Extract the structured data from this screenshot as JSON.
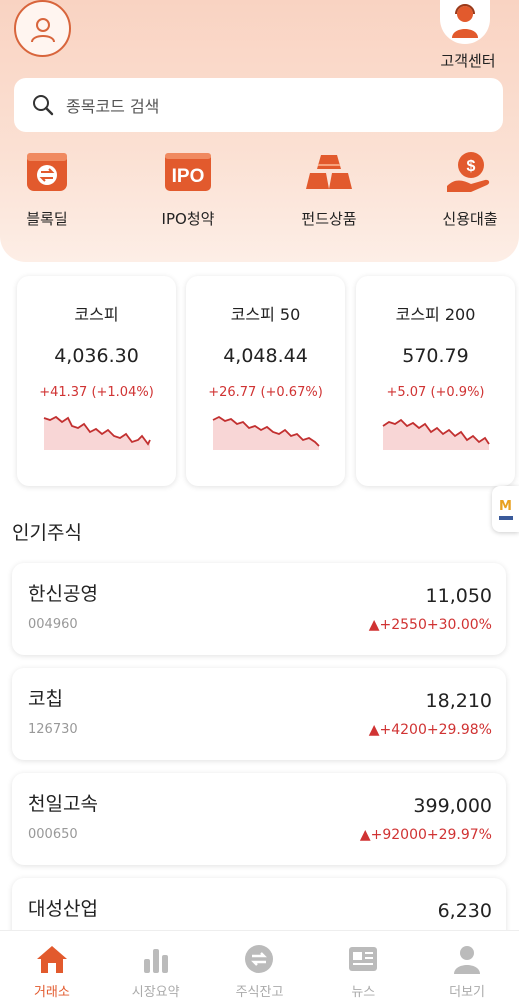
{
  "header": {
    "customer_center_label": "고객센터",
    "search_placeholder": "종목코드 검색"
  },
  "quick_menu": [
    {
      "label": "블록딜",
      "icon": "exchange-icon"
    },
    {
      "label": "IPO청약",
      "icon": "ipo-icon"
    },
    {
      "label": "펀드상품",
      "icon": "gold-bars-icon"
    },
    {
      "label": "신용대출",
      "icon": "loan-coin-icon"
    }
  ],
  "indices": [
    {
      "name": "코스피",
      "value": "4,036.30",
      "change": "+41.37 (+1.04%)"
    },
    {
      "name": "코스피 50",
      "value": "4,048.44",
      "change": "+26.77 (+0.67%)"
    },
    {
      "name": "코스피 200",
      "value": "570.79",
      "change": "+5.07 (+0.9%)"
    }
  ],
  "popular": {
    "title": "인기주식",
    "stocks": [
      {
        "name": "한신공영",
        "code": "004960",
        "price": "11,050",
        "change": "▲+2550+30.00%"
      },
      {
        "name": "코칩",
        "code": "126730",
        "price": "18,210",
        "change": "▲+4200+29.98%"
      },
      {
        "name": "천일고속",
        "code": "000650",
        "price": "399,000",
        "change": "▲+92000+29.97%"
      },
      {
        "name": "대성산업",
        "code": "",
        "price": "6,230",
        "change": ""
      }
    ]
  },
  "side_badge": "M",
  "bottom_nav": [
    {
      "label": "거래소",
      "icon": "home-icon",
      "active": true
    },
    {
      "label": "시장요약",
      "icon": "bar-chart-icon",
      "active": false
    },
    {
      "label": "주식잔고",
      "icon": "exchange-circle-icon",
      "active": false
    },
    {
      "label": "뉴스",
      "icon": "news-icon",
      "active": false
    },
    {
      "label": "더보기",
      "icon": "person-icon",
      "active": false
    }
  ],
  "colors": {
    "accent": "#e25a2d",
    "up": "#d03333",
    "hero_bg": "#f9d3c2"
  }
}
